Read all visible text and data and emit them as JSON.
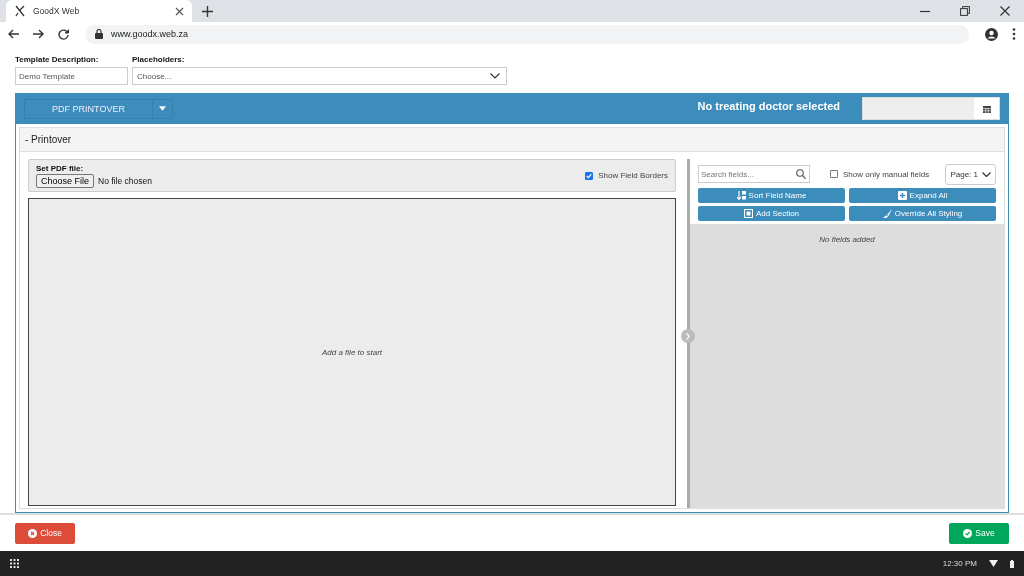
{
  "browser": {
    "tab_title": "GoodX Web",
    "url": "www.goodx.web.za"
  },
  "form": {
    "description_label": "Template Description:",
    "description_value": "Demo Template",
    "placeholders_label": "Placeholders:",
    "placeholders_placeholder": "Choose..."
  },
  "header": {
    "type_button": "PDF PRINTOVER",
    "doctor_status": "No treating doctor selected"
  },
  "section": {
    "title": "- Printover"
  },
  "file_panel": {
    "label": "Set PDF file:",
    "file_button": "Choose File",
    "file_status": "No file chosen",
    "show_borders_label": "Show Field Borders",
    "show_borders_checked": true,
    "empty_message": "Add a file to start"
  },
  "fields_panel": {
    "search_placeholder": "Search fields...",
    "manual_only_label": "Show only manual fields",
    "manual_only_checked": false,
    "page_select": "Page: 1",
    "buttons": [
      {
        "label": "Sort Field Name",
        "kind": "sort"
      },
      {
        "label": "Expand All",
        "kind": "expand"
      },
      {
        "label": "Add Section",
        "kind": "section"
      },
      {
        "label": "Override All Styling",
        "kind": "brush"
      }
    ],
    "empty_message": "No fields added"
  },
  "footer": {
    "close_button": "Close",
    "save_button": "Save"
  },
  "taskbar": {
    "time": "12:30 PM"
  }
}
